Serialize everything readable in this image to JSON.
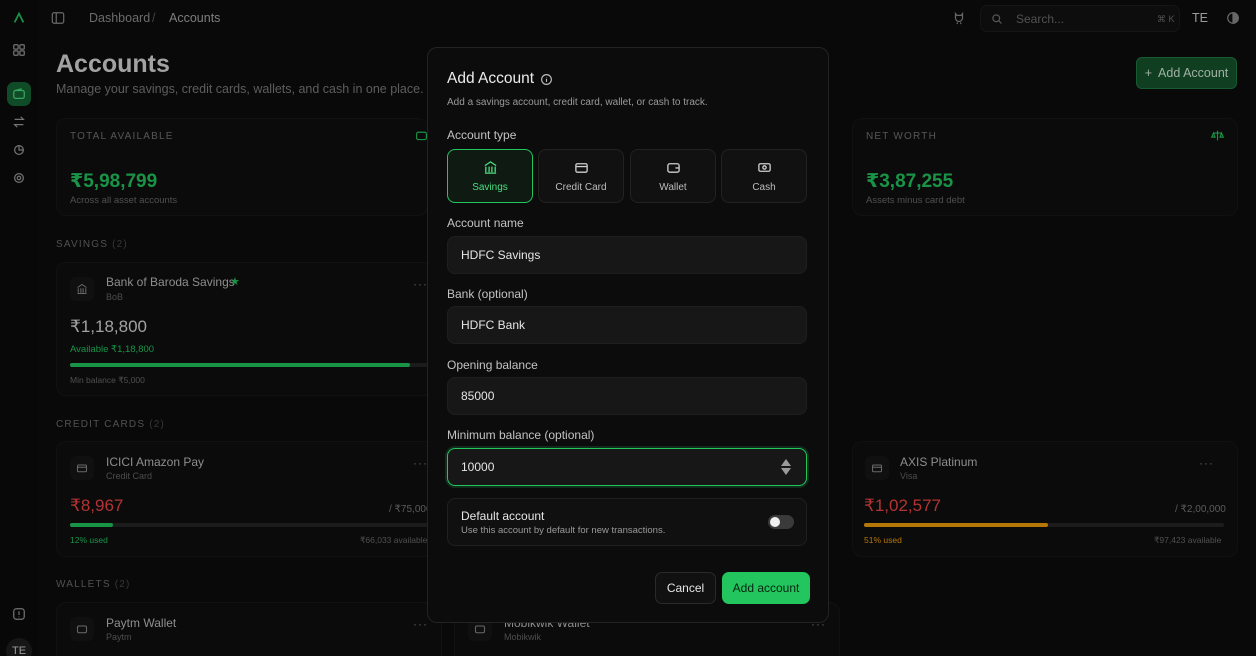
{
  "topbar": {
    "crumb1": "Dashboard",
    "sep": "/",
    "crumb2": "Accounts",
    "search_placeholder": "Search...",
    "search_kbd": "⌘ K",
    "user": "TE"
  },
  "page": {
    "title": "Accounts",
    "subtitle": "Manage your savings, credit cards, wallets, and cash in one place.",
    "add_button": "Add Account"
  },
  "summary": {
    "total_label": "TOTAL AVAILABLE",
    "total_value": "₹5,98,799",
    "total_note": "Across all asset accounts",
    "net_label": "NET WORTH",
    "net_value": "₹3,87,255",
    "net_note": "Assets minus card debt"
  },
  "sections": {
    "savings": {
      "title": "SAVINGS",
      "count": "(2)"
    },
    "credit": {
      "title": "CREDIT CARDS",
      "count": "(2)"
    },
    "wallets": {
      "title": "WALLETS",
      "count": "(2)"
    }
  },
  "accounts": {
    "bob": {
      "name": "Bank of Baroda Savings",
      "sub": "BoB",
      "balance": "₹1,18,800",
      "available": "Available ₹1,18,800",
      "min": "Min balance ₹5,000",
      "fill": 0.95
    },
    "icici": {
      "name": "ICICI Amazon Pay",
      "sub": "Credit Card",
      "balance": "₹8,967",
      "limit": "/ ₹75,000",
      "used": "12% used",
      "avail": "₹66,033 available",
      "fill": 0.12
    },
    "axis": {
      "name": "AXIS Platinum",
      "sub": "Visa",
      "balance": "₹1,02,577",
      "limit": "/ ₹2,00,000",
      "used": "51% used",
      "avail": "₹97,423 available",
      "fill": 0.51
    },
    "paytm": {
      "name": "Paytm Wallet",
      "sub": "Paytm"
    },
    "mobikwik": {
      "name": "Mobikwik Wallet",
      "sub": "Mobikwik"
    }
  },
  "modal": {
    "title": "Add Account",
    "description": "Add a savings account, credit card, wallet, or cash to track.",
    "type_label": "Account type",
    "types": [
      "Savings",
      "Credit Card",
      "Wallet",
      "Cash"
    ],
    "name_label": "Account name",
    "name_value": "HDFC Savings",
    "bank_label": "Bank (optional)",
    "bank_value": "HDFC Bank",
    "opening_label": "Opening balance",
    "opening_value": "85000",
    "min_label": "Minimum balance (optional)",
    "min_value": "10000",
    "default_title": "Default account",
    "default_desc": "Use this account by default for new transactions.",
    "cancel": "Cancel",
    "submit": "Add account"
  },
  "colors": {
    "accent": "#22c55e",
    "warning": "#f59e0b"
  }
}
